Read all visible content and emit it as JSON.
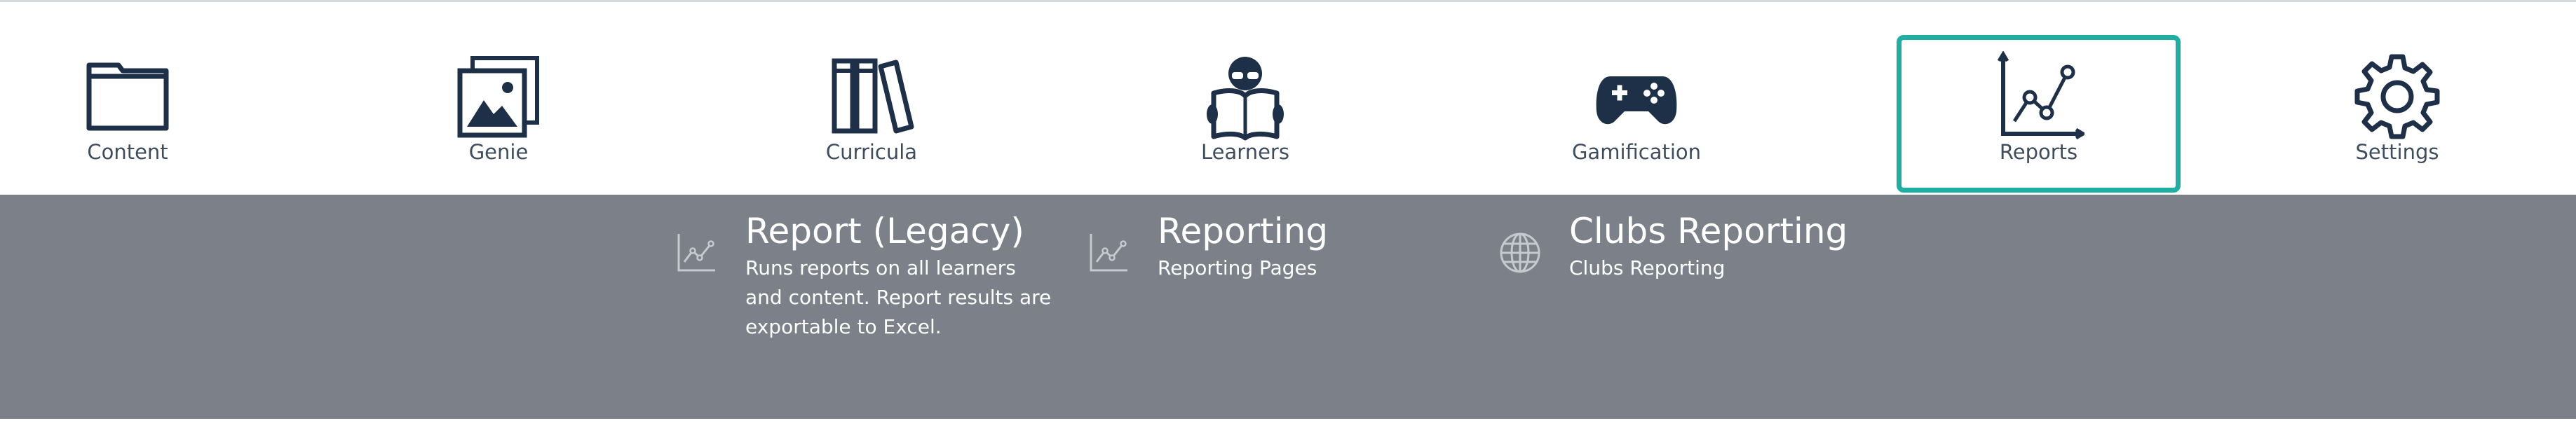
{
  "nav": {
    "items": [
      {
        "label": "Content",
        "icon": "folder-icon"
      },
      {
        "label": "Genie",
        "icon": "image-gallery-icon"
      },
      {
        "label": "Curricula",
        "icon": "books-icon"
      },
      {
        "label": "Learners",
        "icon": "reader-icon"
      },
      {
        "label": "Gamification",
        "icon": "gamepad-icon"
      },
      {
        "label": "Reports",
        "icon": "line-chart-icon"
      },
      {
        "label": "Settings",
        "icon": "gear-icon"
      }
    ],
    "active": "Reports"
  },
  "submenu": {
    "items": [
      {
        "title": "Report (Legacy)",
        "description": "Runs reports on all learners and content. Report results are exportable to Excel.",
        "icon": "chart-icon"
      },
      {
        "title": "Reporting",
        "description": "Reporting Pages",
        "icon": "chart-icon"
      },
      {
        "title": "Clubs Reporting",
        "description": "Clubs Reporting",
        "icon": "globe-icon"
      }
    ]
  },
  "colors": {
    "icon": "#1e3048",
    "text": "#3e4d5e",
    "accent": "#1eaea4",
    "panel": "#7b8089"
  }
}
